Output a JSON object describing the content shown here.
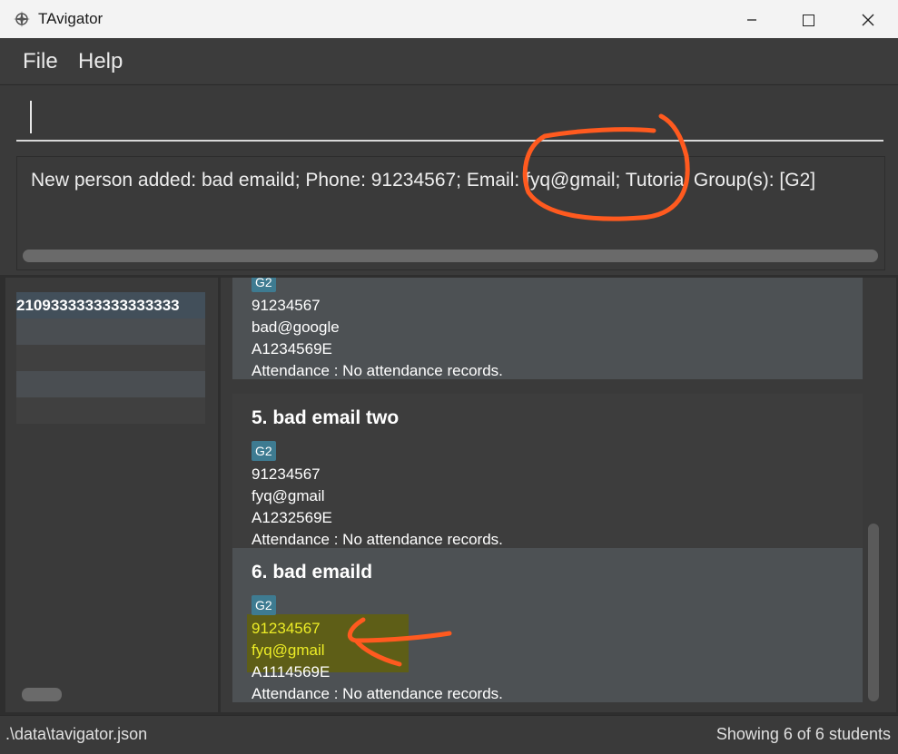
{
  "window": {
    "title": "TAvigator"
  },
  "menu": {
    "file": "File",
    "help": "Help"
  },
  "command": {
    "value": ""
  },
  "result": {
    "text": "New person added: bad emaild; Phone: 91234567; Email: fyq@gmail; Tutorial Group(s): [G2]"
  },
  "tutorial_groups": {
    "items": [
      "2109333333333333333"
    ]
  },
  "persons": [
    {
      "tag": "G2",
      "phone": "91234567",
      "email": "bad@google",
      "matric": "A1234569E",
      "attendance": "Attendance : No attendance records."
    },
    {
      "name": "5.  bad email two",
      "tag": "G2",
      "phone": "91234567",
      "email": "fyq@gmail",
      "matric": "A1232569E",
      "attendance": "Attendance : No attendance records."
    },
    {
      "name": "6.  bad emaild",
      "tag": "G2",
      "phone": "91234567",
      "email": "fyq@gmail",
      "matric": "A1114569E",
      "attendance": "Attendance : No attendance records."
    }
  ],
  "status": {
    "file_path": ".\\data\\tavigator.json",
    "count": "Showing 6 of 6 students"
  },
  "colors": {
    "annotation_stroke": "#ff5a1f",
    "highlight_text": "#ecec26",
    "tag_bg": "#3e7b91"
  }
}
